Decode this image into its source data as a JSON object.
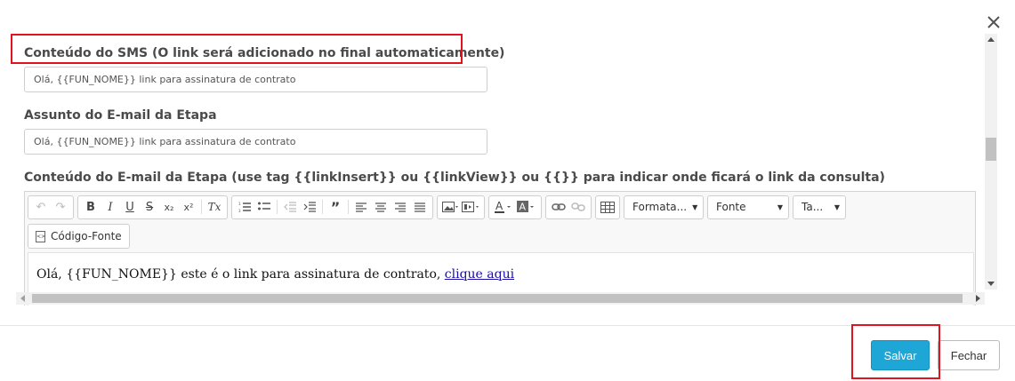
{
  "sms": {
    "label": "Conteúdo do SMS (O link será adicionado no final automaticamente)",
    "value": "Olá, {{FUN_NOME}} link para assinatura de contrato"
  },
  "email_subject": {
    "label": "Assunto do E-mail da Etapa",
    "value": "Olá, {{FUN_NOME}} link para assinatura de contrato"
  },
  "email_content": {
    "label": "Conteúdo do E-mail da Etapa (use tag {{linkInsert}} ou {{linkView}} ou {{}} para indicar onde ficará o link da consulta)",
    "body_text": "Olá, {{FUN_NOME}} este é o link para assinatura de contrato, ",
    "body_link": "clique aqui"
  },
  "toolbar": {
    "undo": "↶",
    "redo": "↷",
    "bold": "B",
    "italic": "I",
    "underline": "U",
    "strike": "S",
    "subscript": "x₂",
    "superscript": "x²",
    "clear_format": "Tx",
    "format_label": "Formata...",
    "font_label": "Fonte",
    "size_label": "Ta...",
    "source_label": "Código-Fonte"
  },
  "footer": {
    "save_label": "Salvar",
    "close_label": "Fechar"
  },
  "colors": {
    "primary": "#1ea7d6",
    "highlight": "#e0141e"
  }
}
